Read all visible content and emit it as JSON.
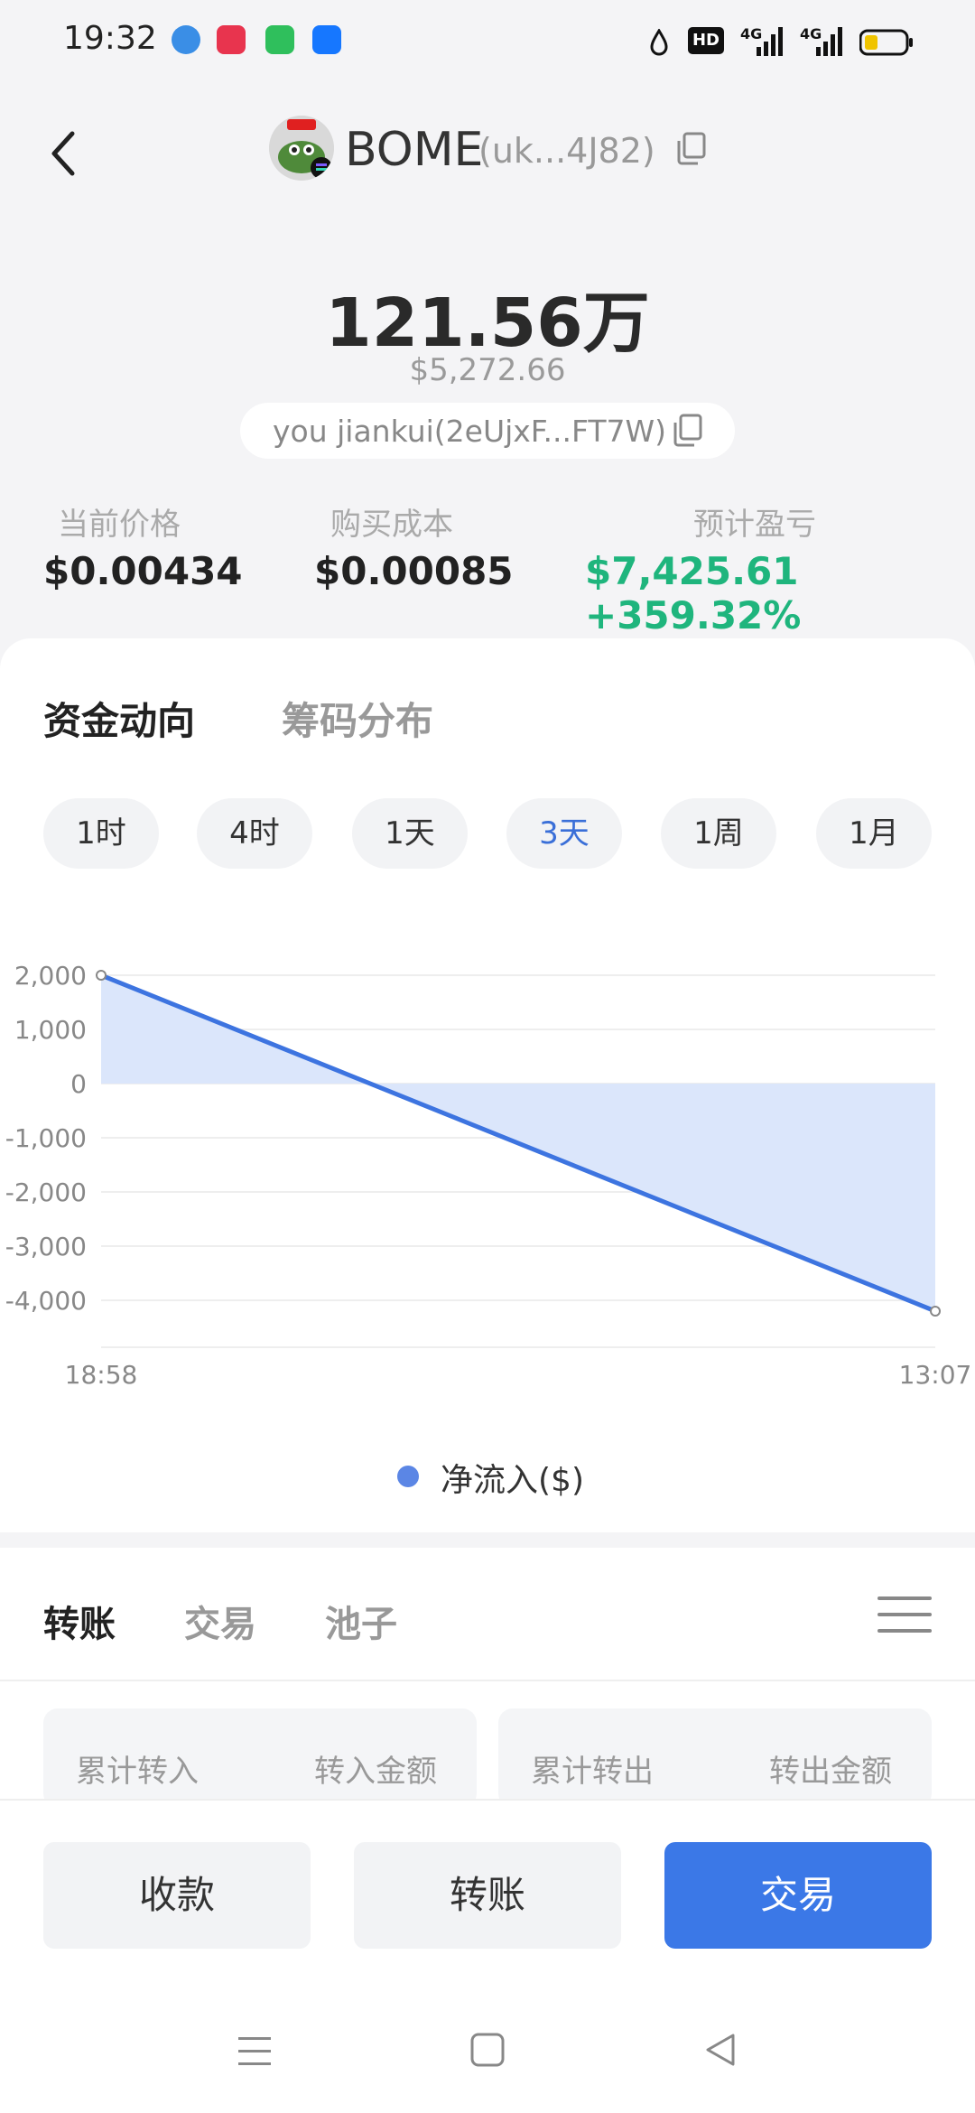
{
  "status_bar": {
    "time": "19:32",
    "network_1": "4G",
    "network_2": "4G",
    "hd_badge": "HD"
  },
  "header": {
    "token_name": "BOME",
    "token_address": "(uk...4J82)"
  },
  "summary": {
    "balance": "121.56万",
    "balance_usd": "$5,272.66",
    "wallet": "you jiankui(2eUjxF...FT7W)"
  },
  "stats": [
    {
      "label": "当前价格",
      "value": "$0.00434"
    },
    {
      "label": "购买成本",
      "value": "$0.00085"
    },
    {
      "label": "预计盈亏",
      "value": "$7,425.61 +359.32%"
    }
  ],
  "colors": {
    "accent": "#3b78e7",
    "profit": "#1fb57d",
    "chart_line": "#3d74e0",
    "chart_fill": "#d9e5fb"
  },
  "tabs": {
    "main": "资金动向",
    "secondary": "筹码分布"
  },
  "ranges": [
    "1时",
    "4时",
    "1天",
    "3天",
    "1周",
    "1月"
  ],
  "active_range": "3天",
  "chart_data": {
    "type": "area",
    "x": [
      "18:58",
      "13:07"
    ],
    "series": [
      {
        "name": "净流入($)",
        "values": [
          2000,
          -4200
        ]
      }
    ],
    "y_ticks": [
      2000,
      1000,
      0,
      -1000,
      -2000,
      -3000,
      -4000
    ],
    "y_tick_labels": [
      "2,000",
      "1,000",
      "0",
      "-1,000",
      "-2,000",
      "-3,000",
      "-4,000"
    ],
    "ylim": [
      -4200,
      2000
    ],
    "legend_position": "bottom-center",
    "grid": true
  },
  "legend_label": "净流入($)",
  "sub_tabs": [
    "转账",
    "交易",
    "池子"
  ],
  "transfer_cards": [
    {
      "left_label": "累计转入",
      "right_label": "转入金额"
    },
    {
      "left_label": "累计转出",
      "right_label": "转出金额"
    }
  ],
  "actions": {
    "receive": "收款",
    "transfer": "转账",
    "trade": "交易"
  }
}
